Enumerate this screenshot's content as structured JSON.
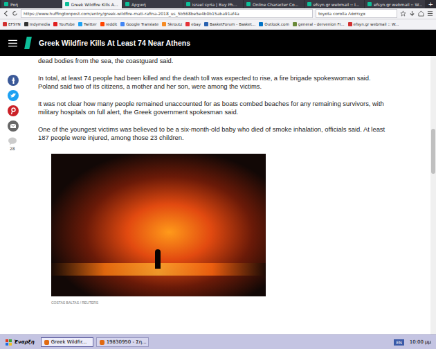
{
  "browser": {
    "tabs": [
      {
        "label": "Ροή",
        "selected": false
      },
      {
        "label": "Greek Wildfire Kills A...",
        "selected": true
      },
      {
        "label": "Αρχική",
        "selected": false
      },
      {
        "label": "israel syria | Buy Ph...",
        "selected": false
      },
      {
        "label": "Online Character Co...",
        "selected": false
      },
      {
        "label": "efsyn.gr webmail :: I...",
        "selected": false
      },
      {
        "label": "efsyn.gr webmail :: W...",
        "selected": false
      }
    ],
    "new_tab": "+",
    "url": "https://www.huffingtonpost.com/entry/greek-wildfire-mati-rafina-2018_us_5b568be5e4b0b15aba91af4a",
    "search": "toyota corolla Λάστιχα",
    "bookmarks": [
      {
        "label": "EFSYN",
        "color": "#d03030"
      },
      {
        "label": "Indymedia",
        "color": "#333333"
      },
      {
        "label": "YouTube",
        "color": "#e02020"
      },
      {
        "label": "Twitter",
        "color": "#1da1f2"
      },
      {
        "label": "reddit",
        "color": "#ff4500"
      },
      {
        "label": "Google Translate",
        "color": "#4285f4"
      },
      {
        "label": "Skroutz",
        "color": "#f68b24"
      },
      {
        "label": "ebay",
        "color": "#e53238"
      },
      {
        "label": "BasketForum - Basket...",
        "color": "#2a62b0"
      },
      {
        "label": "Outlook.com",
        "color": "#0072c6"
      },
      {
        "label": "general - dervenion Fr...",
        "color": "#6a8a3a"
      },
      {
        "label": "efsyn.gr webmail :: W...",
        "color": "#d03030"
      }
    ]
  },
  "page": {
    "site_title": "Greek Wildfire Kills At Least 74 Near Athens",
    "share_count": "28",
    "paragraphs": [
      "dead bodies from the sea, the coastguard said.",
      "In total, at least 74 people had been killed and the death toll was expected to rise, a fire brigade spokeswoman said. Poland said two of its citizens, a mother and her son, were among the victims.",
      "It was not clear how many people remained unaccounted for as boats combed beaches for any remaining survivors, with military hospitals on full alert, the Greek government spokesman said.",
      "One of the youngest victims was believed to be a six-month-old baby who died of smoke inhalation, officials said. At least 187 people were injured, among those 23 children."
    ],
    "photo_credit": "COSTAS BALTAS / REUTERS"
  },
  "taskbar": {
    "start": "Έναρξη",
    "windows": [
      {
        "label": "Greek Wildfir...",
        "selected": true
      },
      {
        "label": "19830950 - Ση...",
        "selected": false
      }
    ],
    "language": "EN",
    "clock": "10:00 μμ"
  }
}
